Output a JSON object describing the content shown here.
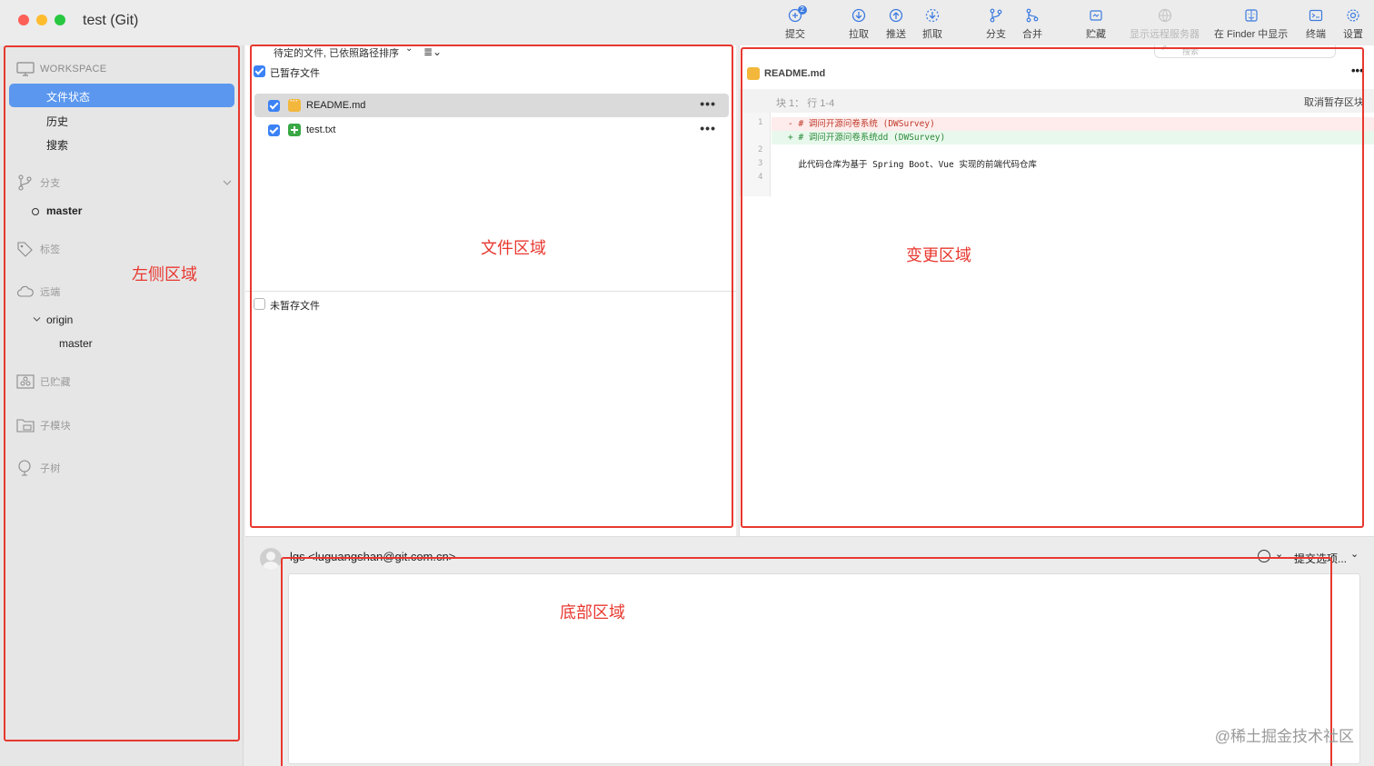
{
  "window": {
    "title": "test (Git)"
  },
  "toolbar": {
    "items": [
      {
        "label": "提交",
        "icon": "commit-icon",
        "badge": "2"
      },
      {
        "label": "拉取",
        "icon": "pull-icon"
      },
      {
        "label": "推送",
        "icon": "push-icon"
      },
      {
        "label": "抓取",
        "icon": "fetch-icon"
      },
      {
        "label": "分支",
        "icon": "branch-icon"
      },
      {
        "label": "合并",
        "icon": "merge-icon"
      },
      {
        "label": "贮藏",
        "icon": "stash-icon"
      },
      {
        "label": "显示远程服务器",
        "icon": "globe-icon"
      },
      {
        "label": "在 Finder 中显示",
        "icon": "finder-icon"
      },
      {
        "label": "终端",
        "icon": "terminal-icon"
      },
      {
        "label": "设置",
        "icon": "gear-icon"
      }
    ],
    "search_placeholder": "搜索"
  },
  "sidebar": {
    "workspace_header": "WORKSPACE",
    "workspace_items": [
      "文件状态",
      "历史",
      "搜索"
    ],
    "branches_header": "分支",
    "branch_current": "master",
    "tags_header": "标签",
    "remotes_header": "远端",
    "remote_name": "origin",
    "remote_branch": "master",
    "stashes_header": "已贮藏",
    "submodules_header": "子模块",
    "subtrees_header": "子树"
  },
  "files": {
    "sort_label": "待定的文件, 已依照路径排序",
    "staged_header": "已暂存文件",
    "unstaged_header": "未暂存文件",
    "staged": [
      {
        "name": "README.md",
        "status": "modified"
      },
      {
        "name": "test.txt",
        "status": "added"
      }
    ]
  },
  "diff": {
    "filename": "README.md",
    "hunk_label": "块 1： 行 1-4",
    "unstage_button": "取消暂存区块",
    "lines": [
      {
        "num": "1",
        "kind": "rem",
        "text": "- # 调问开源问卷系统 (DWSurvey)"
      },
      {
        "num": "",
        "kind": "ins",
        "text": "+ # 调问开源问卷系统dd (DWSurvey)"
      },
      {
        "num": "2",
        "kind": "ctx",
        "text": ""
      },
      {
        "num": "3",
        "kind": "ctx",
        "text": "  此代码仓库为基于 Spring Boot、Vue 实现的前端代码仓库"
      },
      {
        "num": "4",
        "kind": "ctx",
        "text": ""
      }
    ]
  },
  "commit": {
    "author": "lgs <luguangshan@git.com.cn>",
    "options_label": "提交选项..."
  },
  "annotations": {
    "left": "左侧区域",
    "files": "文件区域",
    "changes": "变更区域",
    "bottom": "底部区域"
  },
  "watermark": "@稀土掘金技术社区",
  "colors": {
    "annotation_red": "#e8382f",
    "selection_blue": "#5b97ee",
    "added_green": "#39a845",
    "modified_orange": "#f3b73c"
  }
}
